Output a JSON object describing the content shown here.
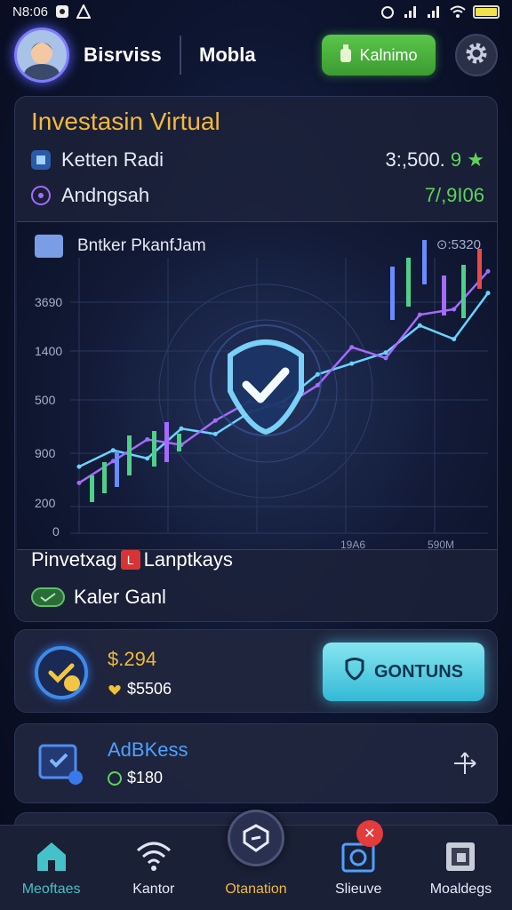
{
  "status_bar": {
    "time": "N8:06",
    "icons": [
      "photo-icon",
      "alert-icon"
    ],
    "right_icons": [
      "alarm-icon",
      "signal-icon",
      "signal-icon",
      "wifi-icon",
      "battery-icon"
    ]
  },
  "header": {
    "title": "Bisrviss",
    "subtitle": "Mobla",
    "button_label": "Kalnimo"
  },
  "main": {
    "title": "Investasin Virtual",
    "row1": {
      "label": "Ketten Radi",
      "value": "3:,500.",
      "value_green": "9 ★"
    },
    "row2": {
      "label": "Andngsah",
      "value": "7/,9I06"
    },
    "chart_label": "Bntker PkanfJam",
    "chart_topright": "⊙:5320",
    "below_label_a": "Pinvetxag",
    "below_badge": "L",
    "below_label_b": "Lanptkays",
    "toggle_label": "Kaler Ganl"
  },
  "chart_data": {
    "type": "line",
    "y_ticks": [
      "3690",
      "1400",
      "500",
      "900",
      "200",
      "0"
    ],
    "x_ticks": [
      "19A6",
      "590M"
    ],
    "series": [
      {
        "values": [
          180,
          240,
          210,
          320,
          300,
          380,
          420,
          520,
          560,
          600,
          700,
          650,
          820
        ]
      },
      {
        "values": [
          120,
          200,
          280,
          260,
          350,
          420,
          400,
          480,
          620,
          580,
          740,
          760,
          900
        ]
      }
    ]
  },
  "card2": {
    "amount": "$.294",
    "sub": "$5506",
    "button_label": "GONTUNS"
  },
  "card3": {
    "title": "AdBKess",
    "sub": "$180"
  },
  "nav": [
    {
      "label": "Meoftaes",
      "icon": "home-icon"
    },
    {
      "label": "Kantor",
      "icon": "wifi-icon"
    },
    {
      "label": "Otanation",
      "icon": "shield-icon"
    },
    {
      "label": "Slieuve",
      "icon": "camera-icon",
      "badge": "✕"
    },
    {
      "label": "Moaldegs",
      "icon": "wallet-icon"
    }
  ],
  "colors": {
    "accent_gold": "#f4b83e",
    "accent_green": "#5fd35a",
    "accent_cyan": "#45c1c9",
    "accent_blue": "#4fa0ff"
  }
}
